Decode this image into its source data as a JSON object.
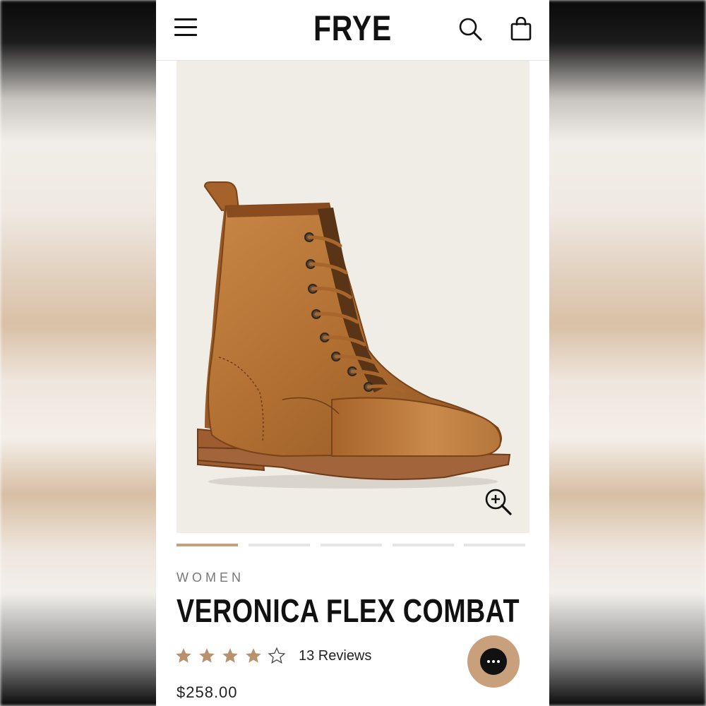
{
  "header": {
    "logo": "FRYE",
    "menu_icon": "hamburger-menu-icon",
    "search_icon": "search-icon",
    "bag_icon": "shopping-bag-icon"
  },
  "gallery": {
    "image_bg": "#efede6",
    "zoom_icon": "zoom-in-icon",
    "slides_total": 5,
    "active_slide": 1
  },
  "product": {
    "category": "WOMEN",
    "title": "VERONICA FLEX COMBAT",
    "rating": 4,
    "rating_max": 5,
    "reviews_label": "13 Reviews",
    "price": "$258.00"
  },
  "chat": {
    "icon": "chat-bubble-icon",
    "color": "#c9a07c"
  },
  "colors": {
    "accent": "#c5a07f",
    "star": "#b8916d",
    "text": "#111111"
  }
}
